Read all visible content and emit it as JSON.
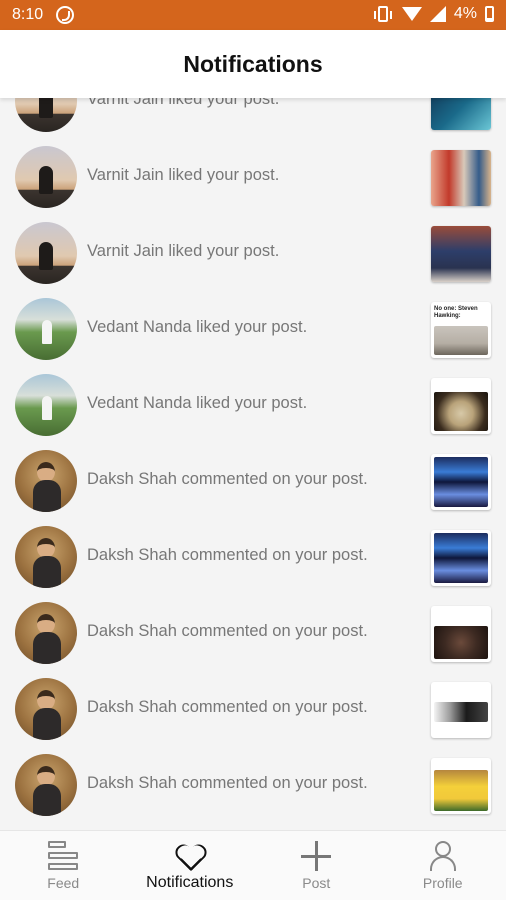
{
  "status_bar": {
    "time": "8:10",
    "battery_percent": "4%",
    "icons": [
      "whatsapp-icon",
      "vibrate-icon",
      "wifi-icon",
      "signal-icon",
      "battery-icon"
    ],
    "color": "#d4651c"
  },
  "header": {
    "title": "Notifications"
  },
  "notifications": [
    {
      "text": "Varnit Jain liked your post.",
      "avatar": "sunset",
      "thumb": "blue"
    },
    {
      "text": "Varnit Jain liked your post.",
      "avatar": "sunset",
      "thumb": "people"
    },
    {
      "text": "Varnit Jain liked your post.",
      "avatar": "sunset",
      "thumb": "man"
    },
    {
      "text": "Vedant Nanda liked your post.",
      "avatar": "field",
      "thumb": "room",
      "thumb_caption": "No one: Steven Hawking:"
    },
    {
      "text": "Vedant Nanda liked your post.",
      "avatar": "field",
      "thumb": "computer"
    },
    {
      "text": "Daksh Shah commented on your post.",
      "avatar": "daksh",
      "thumb": "brain"
    },
    {
      "text": "Daksh Shah commented on your post.",
      "avatar": "daksh",
      "thumb": "brain"
    },
    {
      "text": "Daksh Shah commented on your post.",
      "avatar": "daksh",
      "thumb": "face"
    },
    {
      "text": "Daksh Shah commented on your post.",
      "avatar": "daksh",
      "thumb": "bw"
    },
    {
      "text": "Daksh Shah commented on your post.",
      "avatar": "daksh",
      "thumb": "pika"
    }
  ],
  "bottom_nav": {
    "items": [
      {
        "label": "Feed",
        "icon": "feed-icon"
      },
      {
        "label": "Notifications",
        "icon": "heart-icon",
        "active": true
      },
      {
        "label": "Post",
        "icon": "plus-icon"
      },
      {
        "label": "Profile",
        "icon": "profile-icon"
      }
    ]
  }
}
